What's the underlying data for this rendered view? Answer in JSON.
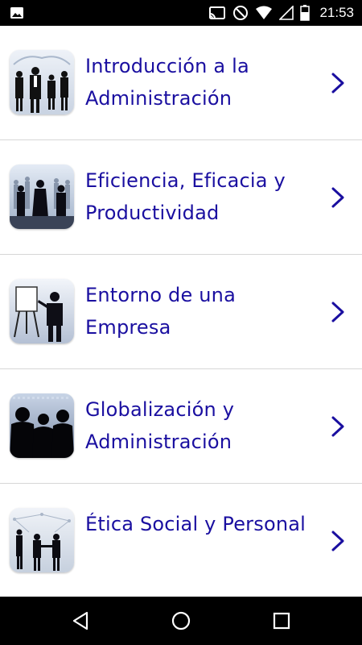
{
  "status_bar": {
    "time": "21:53",
    "icons": [
      "image-icon",
      "cast-icon",
      "do-not-disturb-icon",
      "wifi-icon",
      "signal-icon",
      "battery-icon"
    ]
  },
  "list": {
    "items": [
      {
        "label": "Introducción a la Administración",
        "thumb": "business-people-thumbnail"
      },
      {
        "label": "Eficiencia, Eficacia y Productividad",
        "thumb": "crowd-thumbnail"
      },
      {
        "label": "Entorno de una Empresa",
        "thumb": "presentation-thumbnail"
      },
      {
        "label": "Globalización y Administración",
        "thumb": "silhouettes-thumbnail"
      },
      {
        "label": "Ética Social y Personal",
        "thumb": "handshake-thumbnail"
      }
    ]
  },
  "nav_bar": {
    "icons": [
      "back-icon",
      "home-icon",
      "recents-icon"
    ]
  },
  "colors": {
    "label": "#1a0fa0",
    "divider": "#d6d6d6",
    "bars": "#000000"
  }
}
